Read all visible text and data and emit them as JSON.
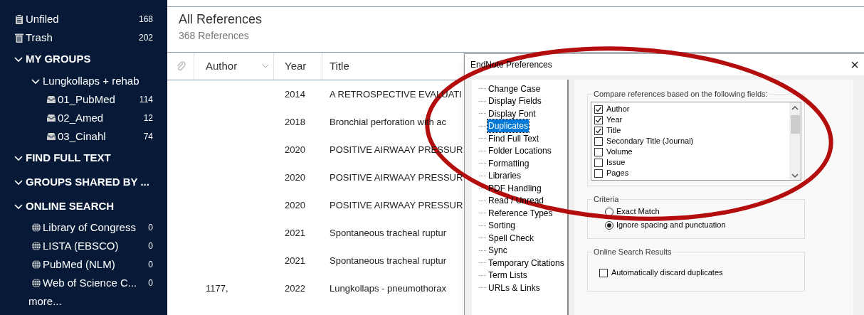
{
  "sidebar": {
    "top_items": [
      {
        "kind": "unfiled",
        "label": "Unfiled",
        "count": "168"
      },
      {
        "kind": "trash",
        "label": "Trash",
        "count": "202"
      }
    ],
    "sections": [
      {
        "title": "MY GROUPS",
        "expanded": true,
        "groups": [
          {
            "label": "Lungkollaps + rehab",
            "expanded": true,
            "children": [
              {
                "label": "01_PubMed",
                "count": "114"
              },
              {
                "label": "02_Amed",
                "count": "12"
              },
              {
                "label": "03_Cinahl",
                "count": "74"
              }
            ]
          }
        ]
      },
      {
        "title": "FIND FULL TEXT",
        "expanded": true
      },
      {
        "title": "GROUPS SHARED BY ...",
        "expanded": true
      },
      {
        "title": "ONLINE SEARCH",
        "expanded": true,
        "items": [
          {
            "label": "Library of Congress",
            "count": "0"
          },
          {
            "label": "LISTA (EBSCO)",
            "count": "0"
          },
          {
            "label": "PubMed (NLM)",
            "count": "0"
          },
          {
            "label": "Web of Science C...",
            "count": "0"
          }
        ],
        "more": "more..."
      }
    ]
  },
  "library": {
    "title": "All References",
    "count": "368 References",
    "columns": [
      "Author",
      "Year",
      "Title"
    ],
    "rows": [
      {
        "author": "",
        "year": "2014",
        "title": "A RETROSPECTIVE EVALUATI"
      },
      {
        "author": "",
        "year": "2018",
        "title": "Bronchial perforation with ac"
      },
      {
        "author": "",
        "year": "2020",
        "title": "POSITIVE AIRWAAY PRESSUR"
      },
      {
        "author": "",
        "year": "2020",
        "title": "POSITIVE AIRWAAY PRESSUR"
      },
      {
        "author": "",
        "year": "2020",
        "title": "POSITIVE AIRWAAY PRESSUR"
      },
      {
        "author": "",
        "year": "2021",
        "title": "Spontaneous tracheal ruptur"
      },
      {
        "author": "",
        "year": "2021",
        "title": "Spontaneous tracheal ruptur"
      },
      {
        "author": "1177,",
        "year": "2022",
        "title": "Lungkollaps - pneumothorax"
      }
    ]
  },
  "dialog": {
    "title": "EndNote Preferences",
    "close": "×",
    "tree": [
      {
        "label": "Change Case",
        "selected": false
      },
      {
        "label": "Display Fields",
        "selected": false
      },
      {
        "label": "Display Font",
        "selected": false
      },
      {
        "label": "Duplicates",
        "selected": true
      },
      {
        "label": "Find Full Text",
        "selected": false
      },
      {
        "label": "Folder Locations",
        "selected": false
      },
      {
        "label": "Formatting",
        "selected": false
      },
      {
        "label": "Libraries",
        "selected": false
      },
      {
        "label": "PDF Handling",
        "selected": false
      },
      {
        "label": "Read / Unread",
        "selected": false
      },
      {
        "label": "Reference Types",
        "selected": false
      },
      {
        "label": "Sorting",
        "selected": false
      },
      {
        "label": "Spell Check",
        "selected": false
      },
      {
        "label": "Sync",
        "selected": false
      },
      {
        "label": "Temporary Citations",
        "selected": false
      },
      {
        "label": "Term Lists",
        "selected": false
      },
      {
        "label": "URLs & Links",
        "selected": false
      }
    ],
    "compare": {
      "label": "Compare references based on the following fields:",
      "fields": [
        {
          "label": "Author",
          "checked": true
        },
        {
          "label": "Year",
          "checked": true
        },
        {
          "label": "Title",
          "checked": true
        },
        {
          "label": "Secondary Title (Journal)",
          "checked": false
        },
        {
          "label": "Volume",
          "checked": false
        },
        {
          "label": "Issue",
          "checked": false
        },
        {
          "label": "Pages",
          "checked": false
        }
      ]
    },
    "criteria": {
      "label": "Criteria",
      "options": [
        {
          "label": "Exact Match",
          "selected": false
        },
        {
          "label": "Ignore spacing and punctuation",
          "selected": true
        }
      ]
    },
    "online": {
      "label": "Online Search Results",
      "options": [
        {
          "label": "Automatically discard duplicates",
          "checked": false
        }
      ]
    }
  }
}
